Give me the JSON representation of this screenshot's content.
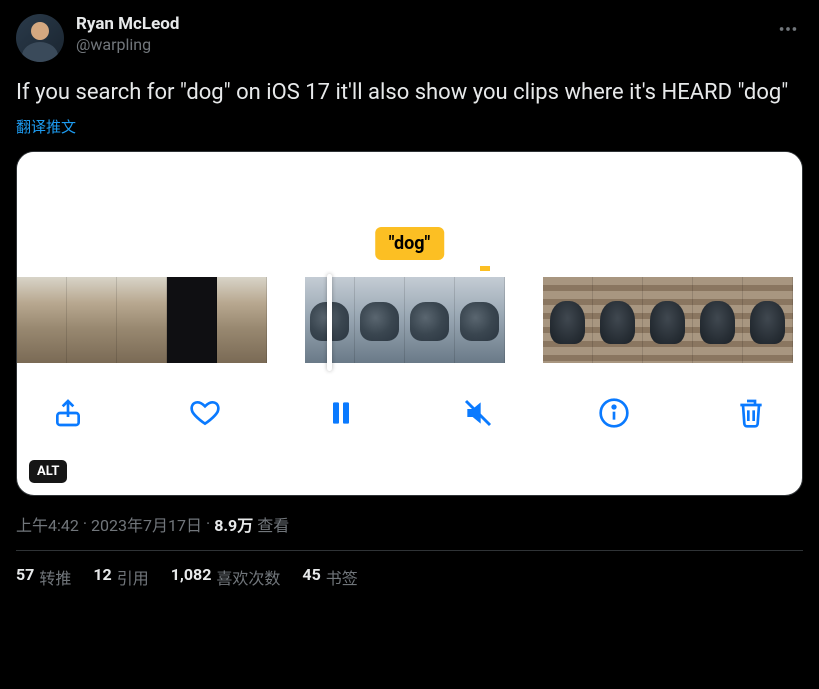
{
  "author": {
    "display_name": "Ryan McLeod",
    "handle": "@warpling"
  },
  "tweet_text": "If you search for \"dog\" on iOS 17 it'll also show you clips where it's HEARD \"dog\"",
  "translate_label": "翻译推文",
  "media": {
    "tooltip_text": "\"dog\"",
    "alt_badge": "ALT"
  },
  "timestamp": {
    "time": "上午4:42",
    "separator": " · ",
    "date": "2023年7月17日",
    "views_count": "8.9万",
    "views_label": "查看"
  },
  "stats": {
    "retweets": {
      "count": "57",
      "label": "转推"
    },
    "quotes": {
      "count": "12",
      "label": "引用"
    },
    "likes": {
      "count": "1,082",
      "label": "喜欢次数"
    },
    "bookmarks": {
      "count": "45",
      "label": "书签"
    }
  }
}
